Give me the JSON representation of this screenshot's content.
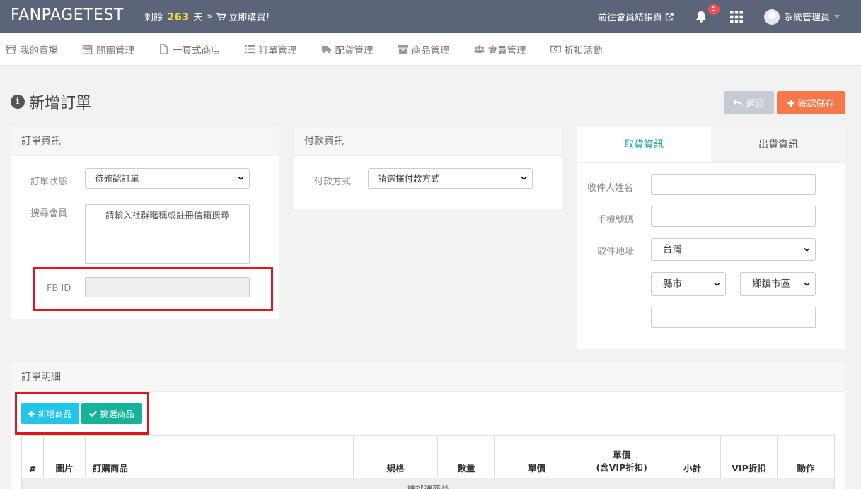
{
  "topbar": {
    "brand": "FANPAGETEST",
    "remain_prefix": "剩餘",
    "remain_days": "263",
    "remain_suffix": "天",
    "arrow": "»",
    "buy_label": "立即購買！",
    "member_link": "前往會員結帳頁",
    "notification_count": "5",
    "user_name": "系統管理員"
  },
  "nav": {
    "items": [
      {
        "label": "我的賣場",
        "icon": "store-icon"
      },
      {
        "label": "開團管理",
        "icon": "calendar-icon"
      },
      {
        "label": "一頁式商店",
        "icon": "file-icon"
      },
      {
        "label": "訂單管理",
        "icon": "list-icon"
      },
      {
        "label": "配貨管理",
        "icon": "truck-icon"
      },
      {
        "label": "商品管理",
        "icon": "archive-icon"
      },
      {
        "label": "會員管理",
        "icon": "users-icon"
      },
      {
        "label": "折扣活動",
        "icon": "money-icon"
      }
    ]
  },
  "page": {
    "title": "新增訂單",
    "back_label": "返回",
    "save_label": "確認儲存"
  },
  "order_info": {
    "heading": "訂單資訊",
    "status_label": "訂單狀態",
    "status_value": "待確認訂單",
    "search_label": "搜尋會員",
    "search_placeholder": "請輸入社群暱稱或註冊信箱搜尋",
    "fbid_label": "FB ID"
  },
  "payment": {
    "heading": "付款資訊",
    "method_label": "付款方式",
    "method_value": "請選擇付款方式"
  },
  "pickup": {
    "tab_active": "取貨資訊",
    "tab_inactive": "出貨資訊",
    "name_label": "收件人姓名",
    "phone_label": "手機號碼",
    "address_label": "取件地址",
    "country_value": "台灣",
    "city_value": "縣市",
    "district_value": "鄉鎮市區"
  },
  "details": {
    "heading": "訂單明細",
    "add_label": "新增商品",
    "pick_label": "挑選商品",
    "columns": [
      "#",
      "圖片",
      "訂購商品",
      "規格",
      "數量",
      "單價",
      "單價\n(含VIP折扣)",
      "小計",
      "VIP折扣",
      "動作"
    ],
    "empty_text": "請挑選商品"
  },
  "colors": {
    "topbar": "#5b6579",
    "accent_teal": "#1aa59a",
    "save_orange": "#f4784a",
    "highlight_red": "#e3141c"
  }
}
